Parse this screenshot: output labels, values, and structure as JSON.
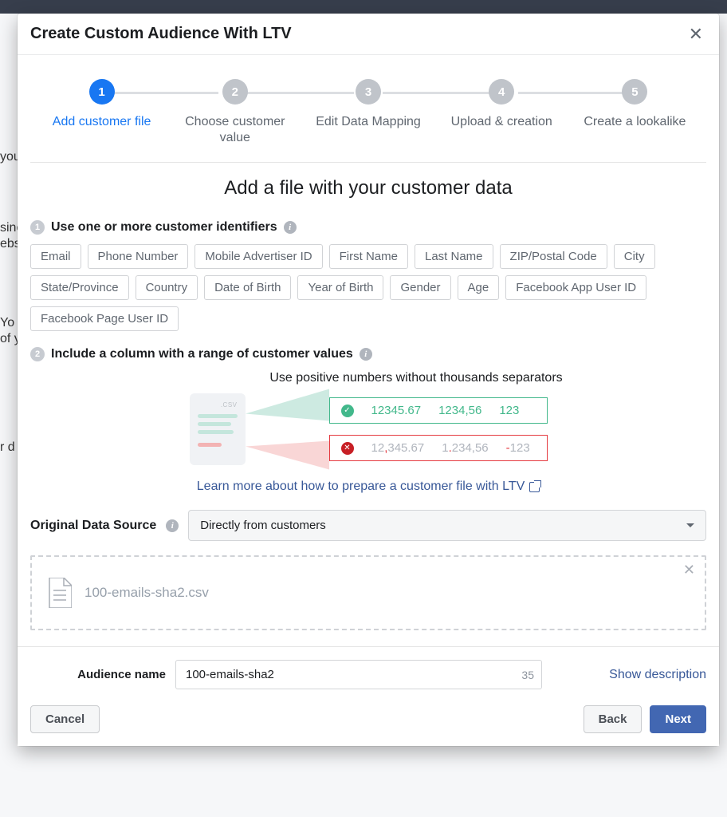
{
  "modal": {
    "title": "Create Custom Audience With LTV"
  },
  "stepper": {
    "steps": [
      {
        "num": "1",
        "label": "Add customer file",
        "active": true
      },
      {
        "num": "2",
        "label": "Choose customer value",
        "active": false
      },
      {
        "num": "3",
        "label": "Edit Data Mapping",
        "active": false
      },
      {
        "num": "4",
        "label": "Upload & creation",
        "active": false
      },
      {
        "num": "5",
        "label": "Create a lookalike",
        "active": false
      }
    ]
  },
  "section": {
    "title": "Add a file with your customer data"
  },
  "sub1": {
    "num": "1",
    "label": "Use one or more customer identifiers",
    "chips": [
      "Email",
      "Phone Number",
      "Mobile Advertiser ID",
      "First Name",
      "Last Name",
      "ZIP/Postal Code",
      "City",
      "State/Province",
      "Country",
      "Date of Birth",
      "Year of Birth",
      "Gender",
      "Age",
      "Facebook App User ID",
      "Facebook Page User ID"
    ]
  },
  "sub2": {
    "num": "2",
    "label": "Include a column with a range of customer values",
    "hint": "Use positive numbers without thousands separators",
    "doc_ext": ".CSV",
    "good": [
      "12345.67",
      "1234,56",
      "123"
    ],
    "bad_a_pre": "12",
    "bad_a_comma": ",",
    "bad_a_post": "345.67",
    "bad_b_pre": "1",
    "bad_b_comma": ".",
    "bad_b_post": "234,56",
    "bad_c_neg": "-",
    "bad_c_val": "123",
    "learn_more": "Learn more about how to prepare a customer file with LTV"
  },
  "source": {
    "label": "Original Data Source",
    "value": "Directly from customers"
  },
  "dropzone": {
    "filename": "100-emails-sha2.csv"
  },
  "footer": {
    "audience_label": "Audience name",
    "audience_value": "100-emails-sha2",
    "char_count": "35",
    "show_desc": "Show description",
    "cancel": "Cancel",
    "back": "Back",
    "next": "Next"
  },
  "backdrop": {
    "t1": "you",
    "t2": "sinc",
    "t3": "ebs",
    "t4": "Yo",
    "t5": "of y",
    "t6": "r d"
  }
}
